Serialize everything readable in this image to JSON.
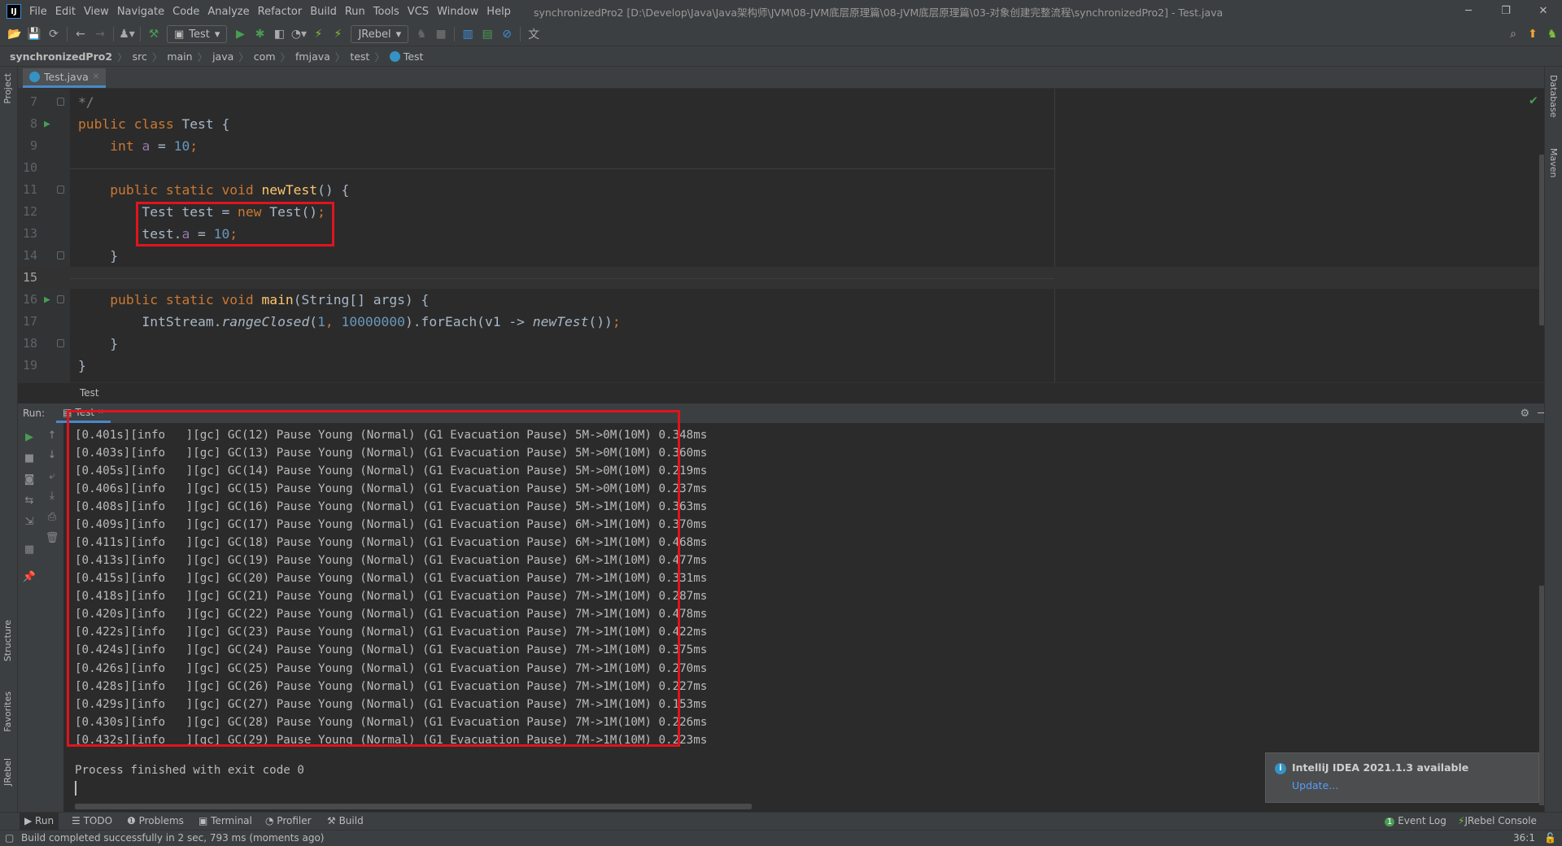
{
  "menubar": {
    "items": [
      "File",
      "Edit",
      "View",
      "Navigate",
      "Code",
      "Analyze",
      "Refactor",
      "Build",
      "Run",
      "Tools",
      "VCS",
      "Window",
      "Help"
    ],
    "title": "synchronizedPro2 [D:\\Develop\\Java\\Java架构师\\JVM\\08-JVM底层原理篇\\08-JVM底层原理篇\\03-对象创建完整流程\\synchronizedPro2] - Test.java"
  },
  "toolbar": {
    "run_config": "Test",
    "jrebel_config": "JRebel"
  },
  "breadcrumb": [
    "synchronizedPro2",
    "src",
    "main",
    "java",
    "com",
    "fmjava",
    "test",
    "Test"
  ],
  "left_stripe": [
    "Project",
    "Structure",
    "Favorites",
    "JRebel"
  ],
  "right_stripe": [
    "Database",
    "Maven"
  ],
  "editor": {
    "tab": "Test.java",
    "footer_breadcrumb": "Test",
    "lines": [
      {
        "n": "7",
        "tokens": [
          [
            "*/",
            "c"
          ]
        ]
      },
      {
        "n": "8",
        "run": true,
        "tokens": [
          [
            "public class ",
            "k"
          ],
          [
            "Test ",
            "d"
          ],
          [
            "{",
            "d"
          ]
        ]
      },
      {
        "n": "9",
        "tokens": [
          [
            "    ",
            "d"
          ],
          [
            "int ",
            "k"
          ],
          [
            "a",
            "f"
          ],
          [
            " = ",
            "d"
          ],
          [
            "10",
            "n"
          ],
          [
            ";",
            "k"
          ]
        ]
      },
      {
        "n": "10",
        "tokens": []
      },
      {
        "n": "11",
        "tokens": [
          [
            "    ",
            "d"
          ],
          [
            "public static void ",
            "k"
          ],
          [
            "newTest",
            "m"
          ],
          [
            "() {",
            "d"
          ]
        ]
      },
      {
        "n": "12",
        "tokens": [
          [
            "        Test test = ",
            "d"
          ],
          [
            "new ",
            "k"
          ],
          [
            "Test()",
            "d"
          ],
          [
            ";",
            "k"
          ]
        ]
      },
      {
        "n": "13",
        "tokens": [
          [
            "        test.",
            "d"
          ],
          [
            "a",
            "f"
          ],
          [
            " = ",
            "d"
          ],
          [
            "10",
            "n"
          ],
          [
            ";",
            "k"
          ]
        ]
      },
      {
        "n": "14",
        "tokens": [
          [
            "    }",
            "d"
          ]
        ]
      },
      {
        "n": "15",
        "current": true,
        "tokens": []
      },
      {
        "n": "16",
        "run": true,
        "tokens": [
          [
            "    ",
            "d"
          ],
          [
            "public static void ",
            "k"
          ],
          [
            "main",
            "m"
          ],
          [
            "(String[] args) {",
            "d"
          ]
        ]
      },
      {
        "n": "17",
        "tokens": [
          [
            "        IntStream.",
            "d"
          ],
          [
            "rangeClosed",
            "i"
          ],
          [
            "(",
            "d"
          ],
          [
            "1",
            "n"
          ],
          [
            ", ",
            "k"
          ],
          [
            "10000000",
            "n"
          ],
          [
            ").forEach(v1 -> ",
            "d"
          ],
          [
            "newTest",
            "i"
          ],
          [
            "())",
            "d"
          ],
          [
            ";",
            "k"
          ]
        ]
      },
      {
        "n": "18",
        "tokens": [
          [
            "    }",
            "d"
          ]
        ]
      },
      {
        "n": "19",
        "tokens": [
          [
            "}",
            "d"
          ]
        ]
      }
    ]
  },
  "run_panel": {
    "label": "Run:",
    "tab": "Test",
    "lines": [
      "[0.401s][info   ][gc] GC(12) Pause Young (Normal) (G1 Evacuation Pause) 5M->0M(10M) 0.348ms",
      "[0.403s][info   ][gc] GC(13) Pause Young (Normal) (G1 Evacuation Pause) 5M->0M(10M) 0.360ms",
      "[0.405s][info   ][gc] GC(14) Pause Young (Normal) (G1 Evacuation Pause) 5M->0M(10M) 0.219ms",
      "[0.406s][info   ][gc] GC(15) Pause Young (Normal) (G1 Evacuation Pause) 5M->0M(10M) 0.237ms",
      "[0.408s][info   ][gc] GC(16) Pause Young (Normal) (G1 Evacuation Pause) 5M->1M(10M) 0.363ms",
      "[0.409s][info   ][gc] GC(17) Pause Young (Normal) (G1 Evacuation Pause) 6M->1M(10M) 0.370ms",
      "[0.411s][info   ][gc] GC(18) Pause Young (Normal) (G1 Evacuation Pause) 6M->1M(10M) 0.468ms",
      "[0.413s][info   ][gc] GC(19) Pause Young (Normal) (G1 Evacuation Pause) 6M->1M(10M) 0.477ms",
      "[0.415s][info   ][gc] GC(20) Pause Young (Normal) (G1 Evacuation Pause) 7M->1M(10M) 0.331ms",
      "[0.418s][info   ][gc] GC(21) Pause Young (Normal) (G1 Evacuation Pause) 7M->1M(10M) 0.287ms",
      "[0.420s][info   ][gc] GC(22) Pause Young (Normal) (G1 Evacuation Pause) 7M->1M(10M) 0.478ms",
      "[0.422s][info   ][gc] GC(23) Pause Young (Normal) (G1 Evacuation Pause) 7M->1M(10M) 0.422ms",
      "[0.424s][info   ][gc] GC(24) Pause Young (Normal) (G1 Evacuation Pause) 7M->1M(10M) 0.375ms",
      "[0.426s][info   ][gc] GC(25) Pause Young (Normal) (G1 Evacuation Pause) 7M->1M(10M) 0.270ms",
      "[0.428s][info   ][gc] GC(26) Pause Young (Normal) (G1 Evacuation Pause) 7M->1M(10M) 0.227ms",
      "[0.429s][info   ][gc] GC(27) Pause Young (Normal) (G1 Evacuation Pause) 7M->1M(10M) 0.153ms",
      "[0.430s][info   ][gc] GC(28) Pause Young (Normal) (G1 Evacuation Pause) 7M->1M(10M) 0.226ms",
      "[0.432s][info   ][gc] GC(29) Pause Young (Normal) (G1 Evacuation Pause) 7M->1M(10M) 0.223ms"
    ],
    "exit_message": "Process finished with exit code 0"
  },
  "notification": {
    "title": "IntelliJ IDEA 2021.1.3 available",
    "link": "Update..."
  },
  "bottom_tabs": [
    "Run",
    "TODO",
    "Problems",
    "Terminal",
    "Profiler",
    "Build"
  ],
  "bottom_right_tabs": {
    "event_log": "Event Log",
    "event_count": "1",
    "jrebel_console": "JRebel Console"
  },
  "status": {
    "message": "Build completed successfully in 2 sec, 793 ms (moments ago)",
    "position": "36:1"
  },
  "colors": {
    "highlight_box": "#e0141e",
    "keyword": "#cc7832",
    "number": "#6897bb",
    "method": "#ffc66d",
    "field": "#9876aa",
    "link": "#589df6"
  }
}
